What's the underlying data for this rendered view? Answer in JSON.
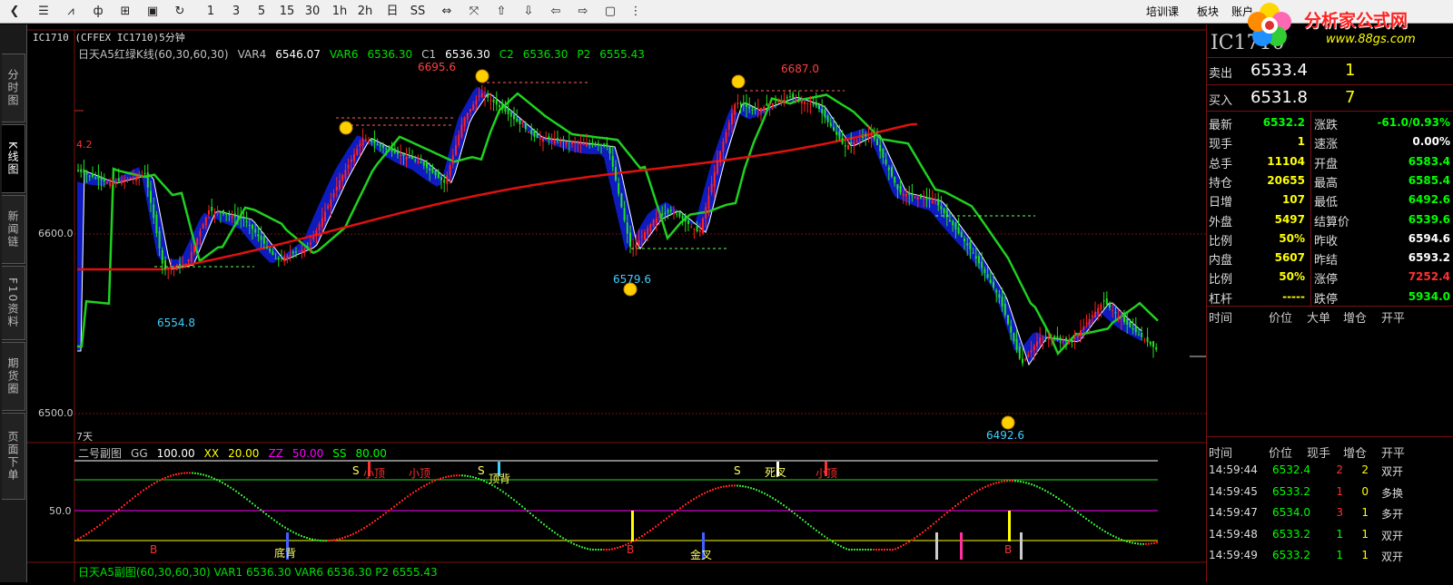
{
  "toolbar": {
    "tf": [
      "1",
      "3",
      "5",
      "15",
      "30",
      "1h",
      "2h",
      "日",
      "SS"
    ],
    "right": [
      "培训课",
      "板块",
      "账户"
    ]
  },
  "logo": {
    "text": "分析家公式网",
    "url": "www.88gs.com"
  },
  "sidetabs": [
    "分时图",
    "K线图",
    "新闻链",
    "F10资料",
    "期货圈",
    "页面下单"
  ],
  "chart": {
    "symbol_line": "IC1710  (CFFEX IC1710)5分钟",
    "main_legend": [
      {
        "text": "日天A5红绿K线(60,30,60,30)",
        "color": "#c0c0c0"
      },
      {
        "text": "VAR4",
        "color": "#c0c0c0"
      },
      {
        "text": "6546.07",
        "color": "#ffffff"
      },
      {
        "text": "VAR6",
        "color": "#00e000"
      },
      {
        "text": "6536.30",
        "color": "#00e000"
      },
      {
        "text": "C1",
        "color": "#c0c0c0"
      },
      {
        "text": "6536.30",
        "color": "#ffffff"
      },
      {
        "text": "C2",
        "color": "#00e000"
      },
      {
        "text": "6536.30",
        "color": "#00e000"
      },
      {
        "text": "P2",
        "color": "#00e000"
      },
      {
        "text": "6555.43",
        "color": "#00e000"
      }
    ],
    "y_labels": [
      "6600.0",
      "6500.0"
    ],
    "y_small": "4.2",
    "period": "7天",
    "annotations": {
      "a1": "6695.6",
      "a2": "6687.0",
      "a3": "6554.8",
      "a4": "6579.6",
      "a5": "6492.6"
    },
    "sub_legend": [
      {
        "text": "二号副图",
        "color": "#c0c0c0"
      },
      {
        "text": "GG",
        "color": "#c0c0c0"
      },
      {
        "text": "100.00",
        "color": "#ffffff"
      },
      {
        "text": "XX",
        "color": "#ffff00"
      },
      {
        "text": "20.00",
        "color": "#ffff00"
      },
      {
        "text": "ZZ",
        "color": "#ff00ff"
      },
      {
        "text": "50.00",
        "color": "#ff00ff"
      },
      {
        "text": "SS",
        "color": "#00ff00"
      },
      {
        "text": "80.00",
        "color": "#00ff00"
      }
    ],
    "sub_y": "50.0",
    "sub_marks": {
      "m1": "S",
      "m2": "小顶",
      "m3": "小顶",
      "m4": "S",
      "m5": "顶背",
      "m6": "S",
      "m7": "死叉",
      "m8": "小顶",
      "m9": "B",
      "m10": "底背",
      "m11": "B",
      "m12": "金叉",
      "m13": "B"
    },
    "bottom_legend": "日天A5副图(60,30,60,30)  VAR1  6536.30   VAR6  6536.30   P2  6555.43"
  },
  "quote": {
    "code": "IC1710",
    "sell": {
      "label": "卖出",
      "price": "6533.4",
      "vol": "1"
    },
    "buy": {
      "label": "买入",
      "price": "6531.8",
      "vol": "7"
    },
    "rows": [
      {
        "l1": "最新",
        "v1": "6532.2",
        "c1": "#00ff00",
        "l2": "涨跌",
        "v2": "-61.0/0.93%",
        "c2": "#00ff00"
      },
      {
        "l1": "现手",
        "v1": "1",
        "c1": "#ffff00",
        "l2": "速涨",
        "v2": "0.00%",
        "c2": "#ffffff"
      },
      {
        "l1": "总手",
        "v1": "11104",
        "c1": "#ffff00",
        "l2": "开盘",
        "v2": "6583.4",
        "c2": "#00ff00"
      },
      {
        "l1": "持仓",
        "v1": "20655",
        "c1": "#ffff00",
        "l2": "最高",
        "v2": "6585.4",
        "c2": "#00ff00"
      },
      {
        "l1": "日增",
        "v1": "107",
        "c1": "#ffff00",
        "l2": "最低",
        "v2": "6492.6",
        "c2": "#00ff00"
      },
      {
        "l1": "外盘",
        "v1": "5497",
        "c1": "#ffff00",
        "l2": "结算价",
        "v2": "6539.6",
        "c2": "#00ff00"
      },
      {
        "l1": "比例",
        "v1": "50%",
        "c1": "#ffff00",
        "l2": "昨收",
        "v2": "6594.6",
        "c2": "#ffffff"
      },
      {
        "l1": "内盘",
        "v1": "5607",
        "c1": "#ffff00",
        "l2": "昨结",
        "v2": "6593.2",
        "c2": "#ffffff"
      },
      {
        "l1": "比例",
        "v1": "50%",
        "c1": "#ffff00",
        "l2": "涨停",
        "v2": "7252.4",
        "c2": "#ff3030"
      },
      {
        "l1": "杠杆",
        "v1": "-----",
        "c1": "#ffff00",
        "l2": "跌停",
        "v2": "5934.0",
        "c2": "#00ff00"
      }
    ],
    "hdr1": [
      "时间",
      "价位",
      "大单",
      "增仓",
      "开平"
    ],
    "hdr2": [
      "时间",
      "价位",
      "现手",
      "增仓",
      "开平"
    ],
    "ticks": [
      {
        "t": "14:59:44",
        "p": "6532.4",
        "v": "2",
        "z": "2",
        "k": "双开",
        "vc": "#ff3030"
      },
      {
        "t": "14:59:45",
        "p": "6533.2",
        "v": "1",
        "z": "0",
        "k": "多换",
        "vc": "#ff3030"
      },
      {
        "t": "14:59:47",
        "p": "6534.0",
        "v": "3",
        "z": "1",
        "k": "多开",
        "vc": "#ff3030"
      },
      {
        "t": "14:59:48",
        "p": "6533.2",
        "v": "1",
        "z": "1",
        "k": "双开",
        "vc": "#00ff00"
      },
      {
        "t": "14:59:49",
        "p": "6533.2",
        "v": "1",
        "z": "1",
        "k": "双开",
        "vc": "#00ff00"
      }
    ]
  }
}
